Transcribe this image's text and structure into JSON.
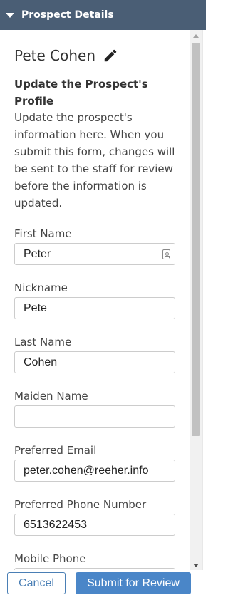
{
  "header": {
    "title": "Prospect Details",
    "icon": "caret-down-icon"
  },
  "prospect": {
    "name": "Pete Cohen",
    "edit_icon": "pencil-icon"
  },
  "section": {
    "title": "Update the Prospect's Profile",
    "description": "Update the prospect's information here. When you submit this form, changes will be sent to the staff for review before the information is updated."
  },
  "fields": [
    {
      "label": "First Name",
      "value": "Peter",
      "icon": "contact-card-icon"
    },
    {
      "label": "Nickname",
      "value": "Pete"
    },
    {
      "label": "Last Name",
      "value": "Cohen"
    },
    {
      "label": "Maiden Name",
      "value": ""
    },
    {
      "label": "Preferred Email",
      "value": "peter.cohen@reeher.info"
    },
    {
      "label": "Preferred Phone Number",
      "value": "6513622453"
    },
    {
      "label": "Mobile Phone",
      "value": ""
    }
  ],
  "buttons": {
    "cancel": "Cancel",
    "submit": "Submit for Review"
  },
  "colors": {
    "header_bg": "#4a5e75",
    "primary": "#4a86c8",
    "cancel_border": "#4a7fb5"
  }
}
